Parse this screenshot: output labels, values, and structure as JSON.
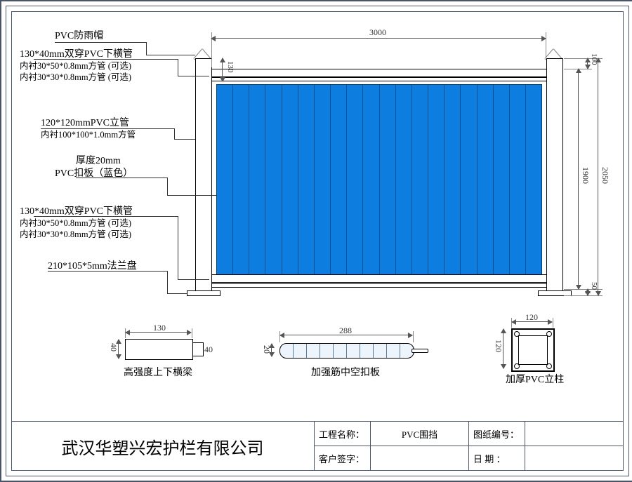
{
  "labels": {
    "rain_cap": "PVC防雨帽",
    "top_rail": "130*40mm双穿PVC下横管",
    "liner_a": "内衬30*50*0.8mm方管 (可选)",
    "liner_b": "内衬30*30*0.8mm方管 (可选)",
    "post": "120*120mmPVC立管",
    "post_liner": "内衬100*100*1.0mm方管",
    "thickness": "厚度20mm",
    "panel_type": "PVC扣板（蓝色）",
    "bottom_rail": "130*40mm双穿PVC下横管",
    "flange": "210*105*5mm法兰盘"
  },
  "details": {
    "crossbeam": "高强度上下横梁",
    "panel": "加强筋中空扣板",
    "post": "加厚PVC立柱"
  },
  "dimensions": {
    "width": "3000",
    "top_gap": "130",
    "post_top": "100",
    "total_h": "2050",
    "panel_h": "1900",
    "base_h": "50",
    "cb_w": "130",
    "cb_h": "40",
    "cb_h2": "40",
    "pnl_w": "288",
    "pnl_h": "20",
    "pst_w": "120",
    "pst_h": "120"
  },
  "title_block": {
    "company": "武汉华塑兴宏护栏有限公司",
    "project_lbl": "工程名称：",
    "project": "PVC围挡",
    "drawing_lbl": "图纸编号：",
    "drawing": "",
    "signature_lbl": "客户签字：",
    "signature": "",
    "date_lbl": "日    期    ：",
    "date": ""
  }
}
